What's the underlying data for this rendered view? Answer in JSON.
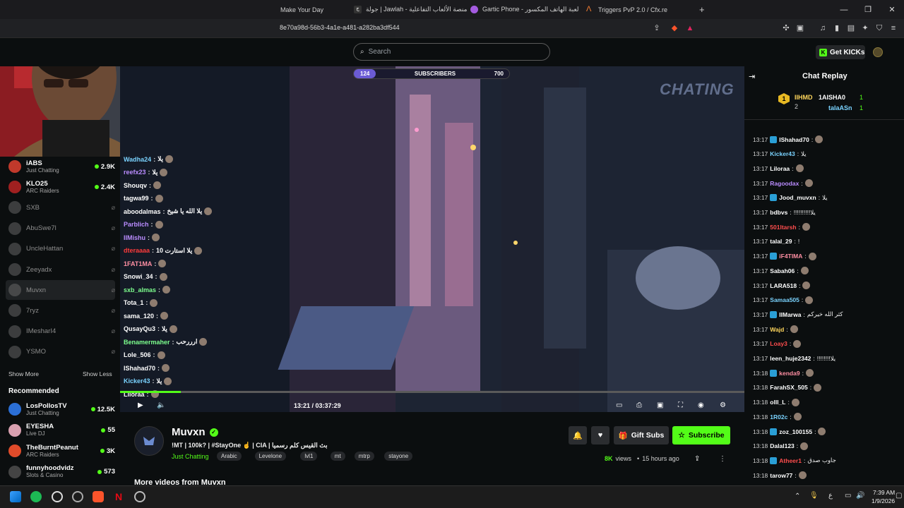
{
  "browser": {
    "tabs": [
      {
        "title": "Make Your Day"
      },
      {
        "title": "جولة | Jawlah - منصة الألعاب التفاعلية"
      },
      {
        "title": "Gartic Phone - لعبة الهاتف المكسور"
      },
      {
        "title": "Triggers PvP 2.0 / Cfx.re"
      }
    ],
    "new_tab": "+",
    "url": "8e70a98d-56b3-4a1e-a481-a282ba3df544"
  },
  "header": {
    "search_placeholder": "Search",
    "get_kicks": "Get KICKs"
  },
  "sidebar": {
    "channels": [
      {
        "name": "iABS",
        "category": "Just Chatting",
        "viewers": "2.9K",
        "live": true,
        "color": "#c0392b"
      },
      {
        "name": "KLO25",
        "category": "ARC Raiders",
        "viewers": "2.4K",
        "live": true,
        "color": "#a02020"
      },
      {
        "name": "SXB",
        "live": false,
        "color": "#777"
      },
      {
        "name": "AbuSwe7l",
        "live": false,
        "color": "#777"
      },
      {
        "name": "UncleHattan",
        "live": false,
        "color": "#777"
      },
      {
        "name": "Zeeyadx",
        "live": false,
        "color": "#777"
      },
      {
        "name": "Muvxn",
        "live": false,
        "color": "#777"
      },
      {
        "name": "7ryz",
        "live": false,
        "color": "#777"
      },
      {
        "name": "IMesharI4",
        "live": false,
        "color": "#777"
      },
      {
        "name": "YSMO",
        "live": false,
        "color": "#777"
      }
    ],
    "show_more": "Show More",
    "show_less": "Show Less",
    "recommended_title": "Recommended",
    "recommended": [
      {
        "name": "LosPollosTV",
        "category": "Just Chatting",
        "viewers": "12.5K",
        "color": "#2b6fd6"
      },
      {
        "name": "EYESHA",
        "category": "Live DJ",
        "viewers": "55",
        "color": "#d9a0b0"
      },
      {
        "name": "TheBurntPeanut",
        "category": "ARC Raiders",
        "viewers": "3K",
        "color": "#e04b2a"
      },
      {
        "name": "funnyhoodvidz",
        "category": "Slots & Casino",
        "viewers": "573",
        "color": "#444"
      }
    ]
  },
  "video": {
    "overlay_text": "CHATING",
    "sub_goal": {
      "current": "124",
      "label": "SUBSCRIBERS",
      "target": "700"
    },
    "overlay_chat": [
      {
        "user": "Wadha24",
        "msg": "يلا",
        "color": "#7ad3ff"
      },
      {
        "user": "reefx23",
        "msg": "يلا",
        "color": "#ba8cff"
      },
      {
        "user": "Shouqv",
        "msg": "",
        "color": "#ffffff"
      },
      {
        "user": "tagwa99",
        "msg": "",
        "color": "#ffffff"
      },
      {
        "user": "aboodalmas",
        "msg": "يلا الله يا شيخ",
        "color": "#ffffff"
      },
      {
        "user": "Parblich",
        "msg": "",
        "color": "#ba8cff"
      },
      {
        "user": "IIMishu",
        "msg": "",
        "color": "#ba8cff"
      },
      {
        "user": "dteraaaa",
        "msg": "يلا استارت 10",
        "color": "#ff3b3b"
      },
      {
        "user": "1FAT1MA",
        "msg": "",
        "color": "#ff8fa3"
      },
      {
        "user": "Snowi_34",
        "msg": "",
        "color": "#ffffff"
      },
      {
        "user": "sxb_almas",
        "msg": "",
        "color": "#7dff8e"
      },
      {
        "user": "Tota_1",
        "msg": "",
        "color": "#ffffff"
      },
      {
        "user": "sama_120",
        "msg": "",
        "color": "#ffffff"
      },
      {
        "user": "QusayQu3",
        "msg": "يلا",
        "color": "#ffffff"
      },
      {
        "user": "Benamermaher",
        "msg": "ارررحب",
        "color": "#7dff8e"
      },
      {
        "user": "Lole_506",
        "msg": "",
        "color": "#ffffff"
      },
      {
        "user": "IShahad70",
        "msg": "",
        "color": "#ffffff"
      },
      {
        "user": "Kicker43",
        "msg": "يلا",
        "color": "#7ad3ff"
      },
      {
        "user": "Liloraa",
        "msg": "",
        "color": "#ffffff"
      }
    ],
    "time_current": "13:21",
    "time_total": "03:37:29",
    "progress": 0.097
  },
  "stream": {
    "channel": "Muvxn",
    "title": "!MT | 100k? | #StayOne ☝️ | CIA | بث القيس كلم رسميا",
    "category": "Just Chatting",
    "tags": [
      "Arabic",
      "Levelone",
      "lvl1",
      "mt",
      "mtrp",
      "stayone"
    ],
    "views": "8K",
    "views_label": "views",
    "age": "15 hours ago",
    "gift_subs": "Gift Subs",
    "subscribe": "Subscribe",
    "more_videos": "More videos from Muvxn"
  },
  "chat": {
    "title": "Chat Replay",
    "top_gifters": {
      "rank1": "1",
      "rank2": "2",
      "user1": "IIHMD",
      "user2": "1AISHA0",
      "user3": "talaASn",
      "count1": "1",
      "count2": "1"
    },
    "messages": [
      {
        "time": "13:17",
        "user": "IShahad70",
        "msg": "",
        "color": "#ffffff"
      },
      {
        "time": "13:17",
        "user": "Kicker43",
        "msg": "يلا",
        "color": "#7ad3ff"
      },
      {
        "time": "13:17",
        "user": "Liloraa",
        "msg": "",
        "color": "#ffffff"
      },
      {
        "time": "13:17",
        "user": "Ragoodax",
        "msg": "",
        "color": "#ba8cff"
      },
      {
        "time": "13:17",
        "user": "Jood_muvxn",
        "msg": "يلا",
        "color": "#ffffff"
      },
      {
        "time": "13:17",
        "user": "bdbvs",
        "msg": "!!!!!!!!!!يلا",
        "color": "#ffffff"
      },
      {
        "time": "13:17",
        "user": "501ltarsh",
        "msg": "",
        "color": "#ff4d4d"
      },
      {
        "time": "13:17",
        "user": "talal_29",
        "msg": "!",
        "color": "#ffffff"
      },
      {
        "time": "13:17",
        "user": "iF4TIMA",
        "msg": "",
        "color": "#ff8fa3"
      },
      {
        "time": "13:17",
        "user": "Sabah06",
        "msg": "",
        "color": "#ffffff"
      },
      {
        "time": "13:17",
        "user": "LARA518",
        "msg": "",
        "color": "#ffffff"
      },
      {
        "time": "13:17",
        "user": "Samaa505",
        "msg": "",
        "color": "#7ad3ff"
      },
      {
        "time": "13:17",
        "user": "IIMarwa",
        "msg": "كثر الله خيركم",
        "color": "#ffffff"
      },
      {
        "time": "13:17",
        "user": "Wajd",
        "msg": "",
        "color": "#ffd65c"
      },
      {
        "time": "13:17",
        "user": "Loay3",
        "msg": "",
        "color": "#ff4d4d"
      },
      {
        "time": "13:17",
        "user": "leen_huje2342",
        "msg": "!!!!!!!!يلا",
        "color": "#ffffff"
      },
      {
        "time": "13:18",
        "user": "kenda9",
        "msg": "",
        "color": "#ff8fa3"
      },
      {
        "time": "13:18",
        "user": "FarahSX_505",
        "msg": "",
        "color": "#ffffff"
      },
      {
        "time": "13:18",
        "user": "olll_L",
        "msg": "",
        "color": "#ffffff"
      },
      {
        "time": "13:18",
        "user": "1R02c",
        "msg": "",
        "color": "#7ad3ff"
      },
      {
        "time": "13:18",
        "user": "zoz_100155",
        "msg": "",
        "color": "#ffffff"
      },
      {
        "time": "13:18",
        "user": "Dalal123",
        "msg": "",
        "color": "#ffffff"
      },
      {
        "time": "13:18",
        "user": "Atheer1",
        "msg": "جاوب صدق",
        "color": "#ff4d4d"
      },
      {
        "time": "13:18",
        "user": "tarow77",
        "msg": "",
        "color": "#ffffff"
      }
    ]
  },
  "taskbar": {
    "time": "7:39 AM",
    "date": "1/9/2026",
    "lang": "ع"
  },
  "colors": {
    "accent": "#53fc18",
    "bg": "#0b0e0f"
  }
}
